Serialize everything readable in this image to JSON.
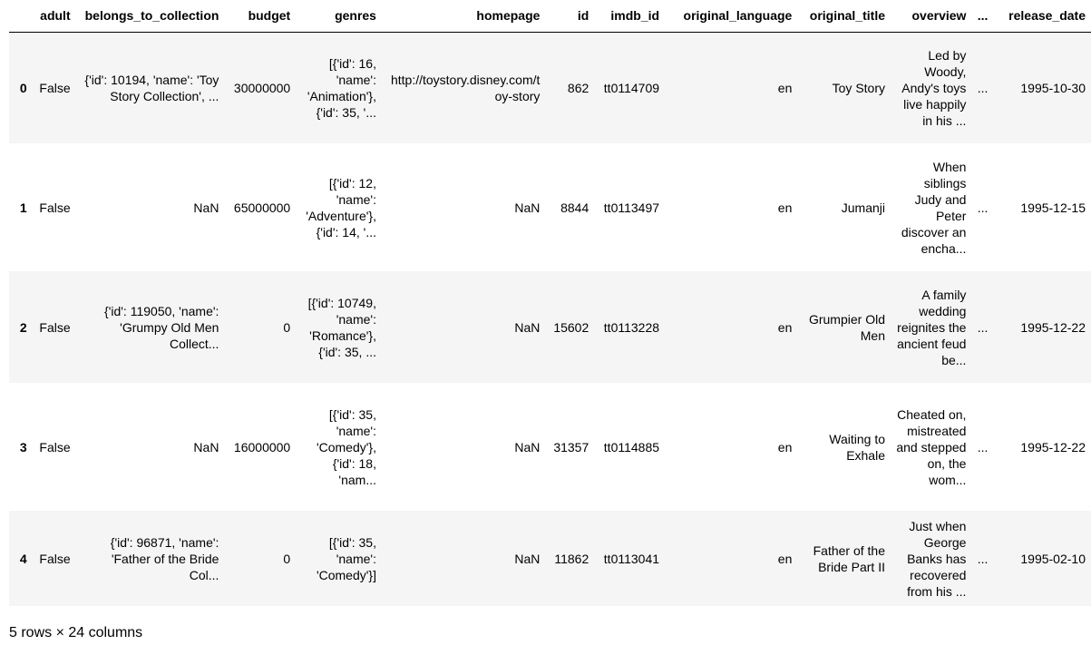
{
  "table": {
    "index_header": "",
    "columns": [
      "adult",
      "belongs_to_collection",
      "budget",
      "genres",
      "homepage",
      "id",
      "imdb_id",
      "original_language",
      "original_title",
      "overview",
      "...",
      "release_date"
    ],
    "rows": [
      {
        "index": "0",
        "cells": [
          "False",
          "{'id': 10194, 'name': 'Toy Story Collection', ...",
          "30000000",
          "[{'id': 16, 'name': 'Animation'}, {'id': 35, '...",
          "http://toystory.disney.com/toy-story",
          "862",
          "tt0114709",
          "en",
          "Toy Story",
          "Led by Woody, Andy's toys live happily in his ...",
          "...",
          "1995-10-30"
        ]
      },
      {
        "index": "1",
        "cells": [
          "False",
          "NaN",
          "65000000",
          "[{'id': 12, 'name': 'Adventure'}, {'id': 14, '...",
          "NaN",
          "8844",
          "tt0113497",
          "en",
          "Jumanji",
          "When siblings Judy and Peter discover an encha...",
          "...",
          "1995-12-15"
        ]
      },
      {
        "index": "2",
        "cells": [
          "False",
          "{'id': 119050, 'name': 'Grumpy Old Men Collect...",
          "0",
          "[{'id': 10749, 'name': 'Romance'}, {'id': 35, ...",
          "NaN",
          "15602",
          "tt0113228",
          "en",
          "Grumpier Old Men",
          "A family wedding reignites the ancient feud be...",
          "...",
          "1995-12-22"
        ]
      },
      {
        "index": "3",
        "cells": [
          "False",
          "NaN",
          "16000000",
          "[{'id': 35, 'name': 'Comedy'}, {'id': 18, 'nam...",
          "NaN",
          "31357",
          "tt0114885",
          "en",
          "Waiting to Exhale",
          "Cheated on, mistreated and stepped on, the wom...",
          "...",
          "1995-12-22"
        ]
      },
      {
        "index": "4",
        "cells": [
          "False",
          "{'id': 96871, 'name': 'Father of the Bride Col...",
          "0",
          "[{'id': 35, 'name': 'Comedy'}]",
          "NaN",
          "11862",
          "tt0113041",
          "en",
          "Father of the Bride Part II",
          "Just when George Banks has recovered from his ...",
          "...",
          "1995-02-10"
        ]
      }
    ]
  },
  "footer": {
    "shape_text": "5 rows × 24 columns"
  },
  "colors": {
    "row_odd": "#f5f5f5",
    "row_even": "#ffffff",
    "header_rule": "#000000"
  }
}
